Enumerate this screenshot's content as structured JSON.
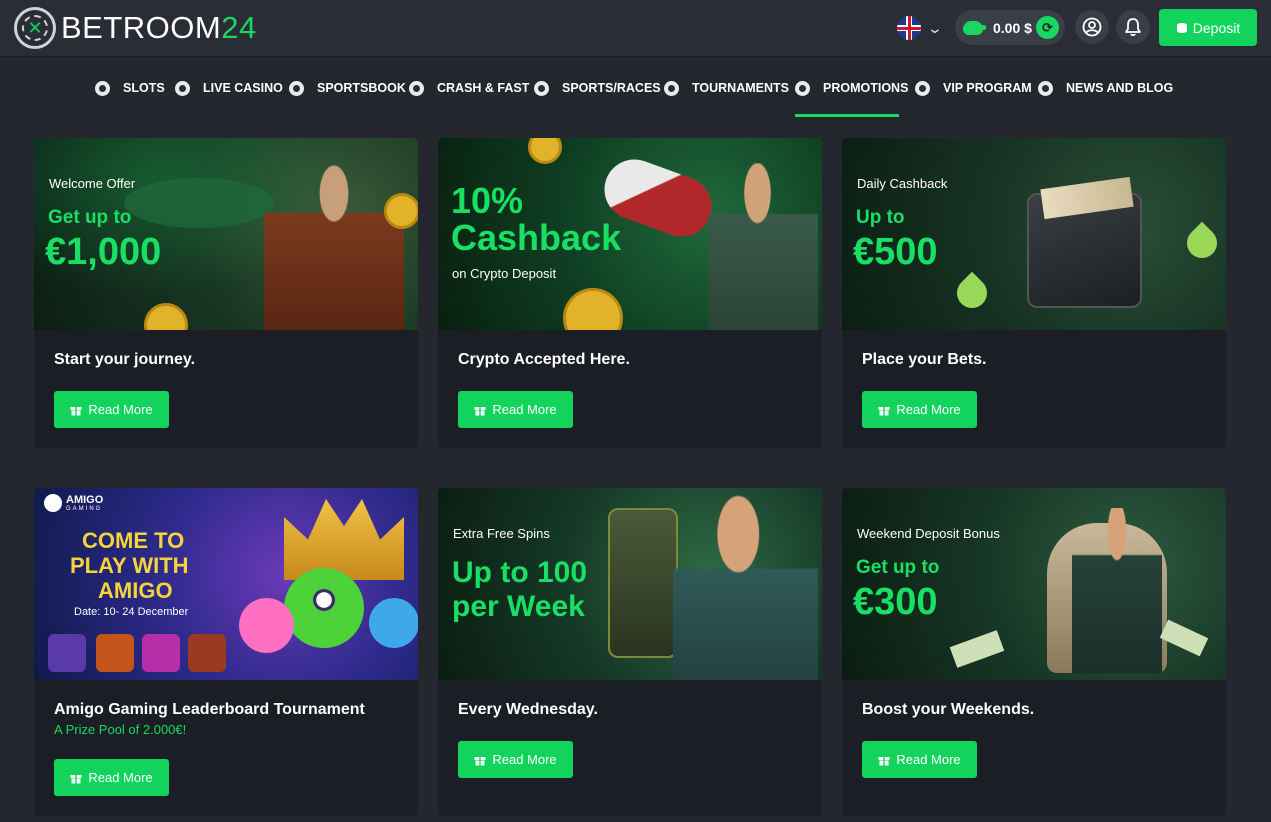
{
  "logo": {
    "bet": "BET",
    "room": "ROOM",
    "num": "24"
  },
  "header": {
    "balance": "0.00 $",
    "deposit_label": "Deposit"
  },
  "nav": {
    "items": [
      {
        "label": "SLOTS"
      },
      {
        "label": "LIVE CASINO"
      },
      {
        "label": "SPORTSBOOK"
      },
      {
        "label": "CRASH & FAST"
      },
      {
        "label": "SPORTS/RACES"
      },
      {
        "label": "TOURNAMENTS"
      },
      {
        "label": "PROMOTIONS",
        "active": true
      },
      {
        "label": "VIP PROGRAM"
      },
      {
        "label": "NEWS AND BLOG"
      }
    ]
  },
  "promos": [
    {
      "banner_label": "Welcome Offer",
      "banner_big1": "Get up to",
      "banner_big2": "€1,000",
      "title": "Start your journey.",
      "button": "Read More"
    },
    {
      "banner_big1": "10%",
      "banner_big2": "Cashback",
      "banner_small": "on Crypto Deposit",
      "title": "Crypto Accepted Here.",
      "button": "Read More"
    },
    {
      "banner_label": "Daily Cashback",
      "banner_big1": "Up to",
      "banner_big2": "€500",
      "title": "Place your Bets.",
      "button": "Read More"
    },
    {
      "banner_brand": "AMIGO",
      "banner_brand_sub": "GAMING",
      "banner_big1": "COME TO",
      "banner_big2": "PLAY WITH",
      "banner_big3": "AMIGO",
      "banner_date": "Date: 10- 24 December",
      "title": "Amigo Gaming Leaderboard Tournament",
      "subtitle": "A Prize Pool of 2.000€!",
      "button": "Read More"
    },
    {
      "banner_label": "Extra Free Spins",
      "banner_big1": "Up to 100",
      "banner_big2": "per Week",
      "title": "Every Wednesday.",
      "button": "Read More"
    },
    {
      "banner_label": "Weekend Deposit Bonus",
      "banner_big1": "Get up to",
      "banner_big2": "€300",
      "title": "Boost your Weekends.",
      "button": "Read More"
    }
  ]
}
